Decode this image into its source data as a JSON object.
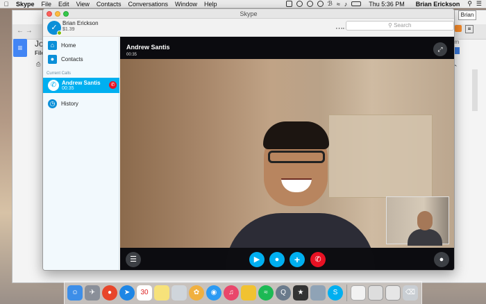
{
  "menubar": {
    "apple": "",
    "items": [
      "Skype",
      "File",
      "Edit",
      "View",
      "Contacts",
      "Conversations",
      "Window",
      "Help"
    ],
    "clock": "Thu 5:36 PM",
    "user": "Brian Erickson"
  },
  "background_window": {
    "doc_title": "Jo",
    "doc_menu": "File",
    "right_tab": "Brian",
    "right_text": "om"
  },
  "skype": {
    "window_title": "Skype",
    "profile": {
      "name": "Brian Erickson",
      "credit": "$1.39"
    },
    "search_placeholder": "Search",
    "sidebar": {
      "home": "Home",
      "contacts": "Contacts",
      "section_current_calls": "Current Calls",
      "current_call": {
        "name": "Andrew Santis",
        "duration": "00:35"
      },
      "history": "History"
    },
    "call": {
      "name": "Andrew Santis",
      "duration": "00:35"
    },
    "colors": {
      "accent": "#00aff0",
      "hangup": "#e81123",
      "online": "#7fba00"
    }
  },
  "dock": {
    "icons": [
      "finder-icon",
      "launchpad-icon",
      "chrome-icon",
      "safari-icon",
      "calendar-icon",
      "notes-icon",
      "preview-icon",
      "photos-icon",
      "messages-icon",
      "itunes-icon",
      "cyberduck-icon",
      "spotify-icon",
      "quicktime-icon",
      "imovie-icon",
      "image-capture-icon",
      "skype-icon",
      "document-icon",
      "screenshot-icon",
      "window-icon",
      "trash-icon"
    ],
    "calendar_day": "30"
  }
}
